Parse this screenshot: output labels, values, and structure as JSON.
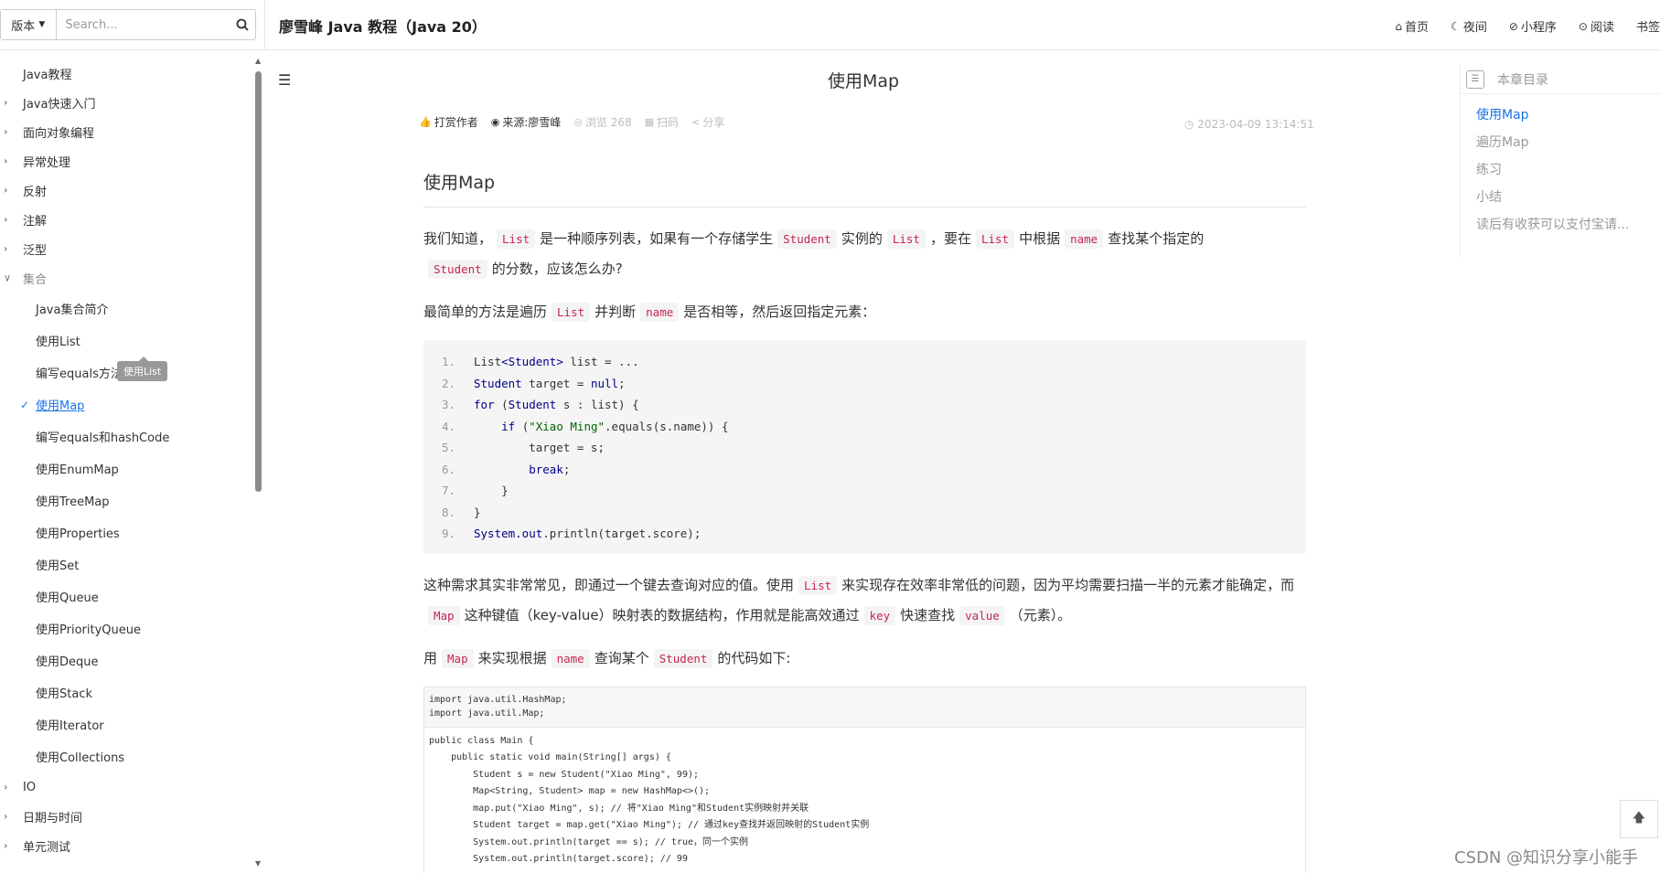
{
  "header": {
    "version_label": "版本",
    "search_placeholder": "Search...",
    "site_title": "廖雪峰 Java 教程（Java 20）",
    "nav": [
      {
        "icon": "home-icon",
        "glyph": "⌂",
        "label": "首页"
      },
      {
        "icon": "moon-icon",
        "glyph": "☾",
        "label": "夜间"
      },
      {
        "icon": "mini-program-icon",
        "glyph": "⊘",
        "label": "小程序"
      },
      {
        "icon": "read-icon",
        "glyph": "⊙",
        "label": "阅读"
      },
      {
        "icon": "bookmark-icon",
        "glyph": "",
        "label": "书签"
      }
    ]
  },
  "sidebar": {
    "items": [
      {
        "label": "Java教程",
        "level": 0,
        "chevron": false
      },
      {
        "label": "Java快速入门",
        "level": 0,
        "chevron": true
      },
      {
        "label": "面向对象编程",
        "level": 0,
        "chevron": true
      },
      {
        "label": "异常处理",
        "level": 0,
        "chevron": true
      },
      {
        "label": "反射",
        "level": 0,
        "chevron": true
      },
      {
        "label": "注解",
        "level": 0,
        "chevron": true
      },
      {
        "label": "泛型",
        "level": 0,
        "chevron": true
      },
      {
        "label": "集合",
        "level": 0,
        "chevron": true,
        "open": true
      },
      {
        "label": "Java集合简介",
        "level": 1
      },
      {
        "label": "使用List",
        "level": 1
      },
      {
        "label": "编写equals方法",
        "level": 1
      },
      {
        "label": "使用Map",
        "level": 1,
        "active": true
      },
      {
        "label": "编写equals和hashCode",
        "level": 1
      },
      {
        "label": "使用EnumMap",
        "level": 1
      },
      {
        "label": "使用TreeMap",
        "level": 1
      },
      {
        "label": "使用Properties",
        "level": 1
      },
      {
        "label": "使用Set",
        "level": 1
      },
      {
        "label": "使用Queue",
        "level": 1
      },
      {
        "label": "使用PriorityQueue",
        "level": 1
      },
      {
        "label": "使用Deque",
        "level": 1
      },
      {
        "label": "使用Stack",
        "level": 1
      },
      {
        "label": "使用Iterator",
        "level": 1
      },
      {
        "label": "使用Collections",
        "level": 1
      },
      {
        "label": "IO",
        "level": 0,
        "chevron": true
      },
      {
        "label": "日期与时间",
        "level": 0,
        "chevron": true
      },
      {
        "label": "单元测试",
        "level": 0,
        "chevron": true
      }
    ],
    "tooltip": "使用List"
  },
  "article": {
    "title": "使用Map",
    "meta": {
      "reward": "打赏作者",
      "source": "来源:廖雪峰",
      "views": "浏览 268",
      "scan": "扫码",
      "share": "分享",
      "date": "2023-04-09 13:14:51"
    },
    "heading": "使用Map",
    "p1": {
      "t1": "我们知道，",
      "c1": "List",
      "t2": "是一种顺序列表，如果有一个存储学生",
      "c2": "Student",
      "t3": "实例的",
      "c3": "List",
      "t4": "，要在",
      "c4": "List",
      "t5": "中根据",
      "c5": "name",
      "t6": "查找某个指定的",
      "c6": "Student",
      "t7": "的分数，应该怎么办?"
    },
    "p2": {
      "t1": "最简单的方法是遍历",
      "c1": "List",
      "t2": "并判断",
      "c2": "name",
      "t3": "是否相等，然后返回指定元素："
    },
    "code1": [
      {
        "n": "1.",
        "html": "List<span class='kw'>&lt;Student&gt;</span> list = ..."
      },
      {
        "n": "2.",
        "html": "<span class='kw'>Student</span> target = <span class='kw'>null</span>;"
      },
      {
        "n": "3.",
        "html": "<span class='kw'>for</span> (<span class='kw'>Student</span> s : list) {"
      },
      {
        "n": "4.",
        "html": "    <span class='kw'>if</span> (<span class='str'>\"Xiao Ming\"</span>.equals(s.name)) {"
      },
      {
        "n": "5.",
        "html": "        target = s;"
      },
      {
        "n": "6.",
        "html": "        <span class='kw'>break</span>;"
      },
      {
        "n": "7.",
        "html": "    }"
      },
      {
        "n": "8.",
        "html": "}"
      },
      {
        "n": "9.",
        "html": "<span class='kw'>System.out</span>.println(target.score);"
      }
    ],
    "p3": {
      "t1": "这种需求其实非常常见，即通过一个键去查询对应的值。使用",
      "c1": "List",
      "t2": "来实现存在效率非常低的问题，因为平均需要扫描一半的元素才能确定，而",
      "c2": "Map",
      "t3": "这种键值（key-value）映射表的数据结构，作用就是能高效通过",
      "c3": "key",
      "t4": "快速查找",
      "c4": "value",
      "t5": "（元素）。"
    },
    "p4": {
      "t1": "用",
      "c1": "Map",
      "t2": "来实现根据",
      "c2": "name",
      "t3": "查询某个",
      "c3": "Student",
      "t4": "的代码如下:"
    },
    "code2_imports": "import java.util.HashMap;\nimport java.util.Map;",
    "code2_body": "public class Main {\n    public static void main(String[] args) {\n        Student s = new Student(\"Xiao Ming\", 99);\n        Map<String, Student> map = new HashMap<>();\n        map.put(\"Xiao Ming\", s); // 将\"Xiao Ming\"和Student实例映射并关联\n        Student target = map.get(\"Xiao Ming\"); // 通过key查找并返回映射的Student实例\n        System.out.println(target == s); // true，同一个实例\n        System.out.println(target.score); // 99"
  },
  "toc": {
    "title": "本章目录",
    "items": [
      "使用Map",
      "遍历Map",
      "练习",
      "小结",
      "读后有收获可以支付宝请..."
    ]
  },
  "watermark": "CSDN @知识分享小能手"
}
